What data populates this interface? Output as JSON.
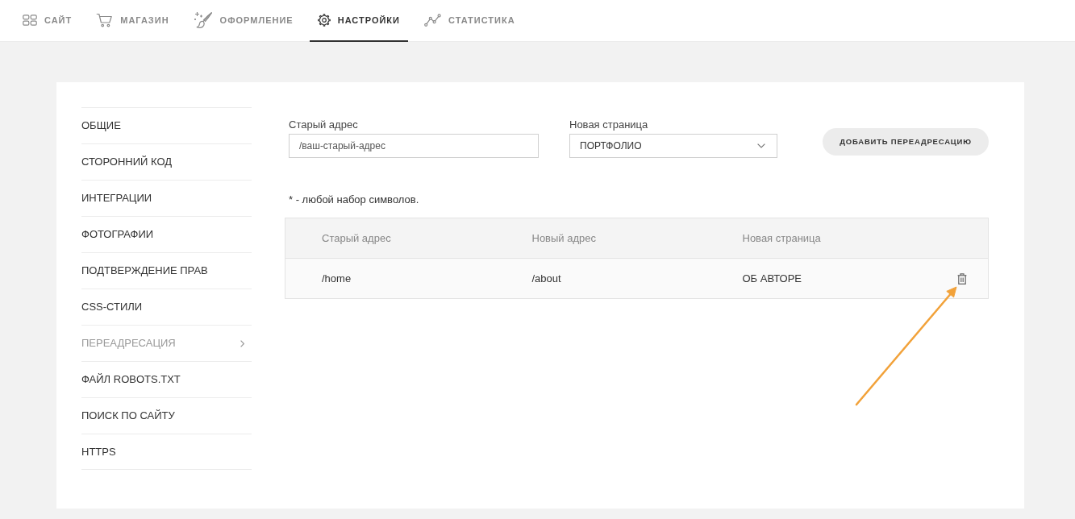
{
  "nav": {
    "tabs": [
      {
        "label": "САЙТ",
        "selected": false
      },
      {
        "label": "МАГАЗИН",
        "selected": false
      },
      {
        "label": "ОФОРМЛЕНИЕ",
        "selected": false
      },
      {
        "label": "НАСТРОЙКИ",
        "selected": true
      },
      {
        "label": "СТАТИСТИКА",
        "selected": false
      }
    ]
  },
  "sidebar": {
    "items": [
      {
        "label": "ОБЩИЕ",
        "selected": false
      },
      {
        "label": "СТОРОННИЙ КОД",
        "selected": false
      },
      {
        "label": "ИНТЕГРАЦИИ",
        "selected": false
      },
      {
        "label": "ФОТОГРАФИИ",
        "selected": false
      },
      {
        "label": "ПОДТВЕРЖДЕНИЕ ПРАВ",
        "selected": false
      },
      {
        "label": "CSS-СТИЛИ",
        "selected": false
      },
      {
        "label": "ПЕРЕАДРЕСАЦИЯ",
        "selected": true
      },
      {
        "label": "ФАЙЛ ROBOTS.TXT",
        "selected": false
      },
      {
        "label": "ПОИСК ПО САЙТУ",
        "selected": false
      },
      {
        "label": "HTTPS",
        "selected": false
      }
    ]
  },
  "redirect_form": {
    "old_address": {
      "label": "Старый адрес",
      "placeholder": "/ваш-старый-адрес"
    },
    "new_page": {
      "label": "Новая страница",
      "value": "ПОРТФОЛИО"
    },
    "add_button": "ДОБАВИТЬ ПЕРЕАДРЕСАЦИЮ",
    "hint": "* - любой набор символов."
  },
  "table": {
    "columns": [
      "Старый адрес",
      "Новый адрес",
      "Новая страница"
    ],
    "rows": [
      {
        "cells": [
          "/home",
          "/about",
          "ОБ АВТОРЕ"
        ]
      }
    ]
  }
}
